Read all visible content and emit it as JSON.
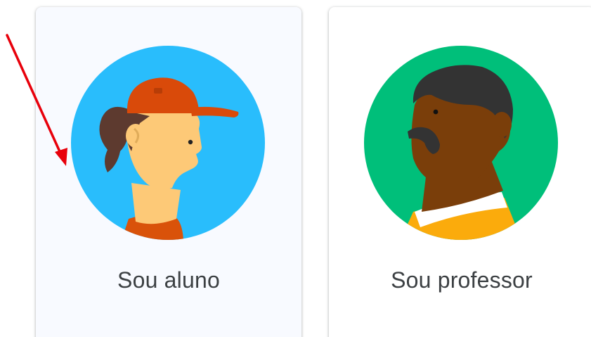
{
  "roles": {
    "student": {
      "label": "Sou aluno",
      "icon": "student-avatar-icon"
    },
    "teacher": {
      "label": "Sou professor",
      "icon": "teacher-avatar-icon"
    }
  },
  "colors": {
    "student_bg": "#29bdfc",
    "teacher_bg": "#00bf7a",
    "cap": "#d94a0a",
    "hair_student": "#5d3a2f",
    "skin_student": "#fdc977",
    "skin_teacher": "#7a3e0a",
    "hair_teacher": "#333333",
    "shirt_teacher": "#fbab0c",
    "annotation_arrow": "#e8000b"
  }
}
